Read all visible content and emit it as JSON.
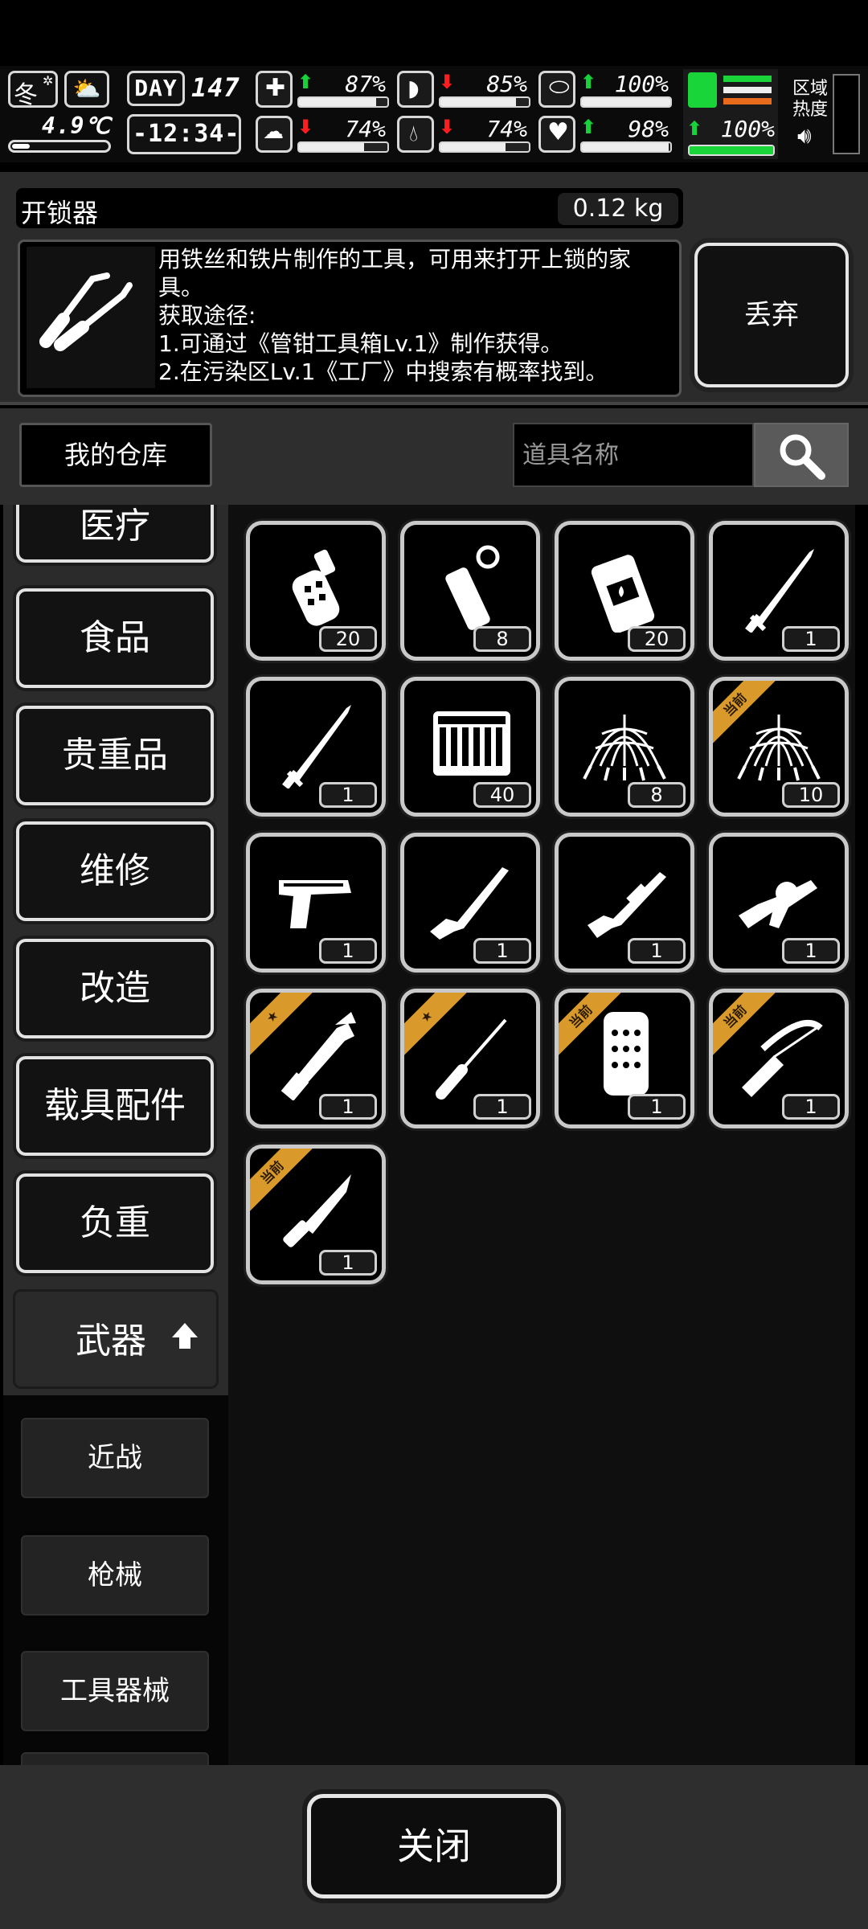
{
  "hud": {
    "season": "冬",
    "temperature": "4.9℃",
    "day_label": "DAY",
    "day_number": "147",
    "time": "-12:34-",
    "stats": [
      {
        "name": "health",
        "trend": "up",
        "percent": "87%",
        "level": 0.87
      },
      {
        "name": "hunger",
        "trend": "down",
        "percent": "85%",
        "level": 0.85
      },
      {
        "name": "sanity",
        "trend": "up",
        "percent": "100%",
        "level": 1.0
      },
      {
        "name": "energy",
        "trend": "down",
        "percent": "74%",
        "level": 0.74
      },
      {
        "name": "thirst",
        "trend": "down",
        "percent": "74%",
        "level": 0.74
      },
      {
        "name": "mood",
        "trend": "up",
        "percent": "98%",
        "level": 0.98
      }
    ],
    "stamina": {
      "trend": "up",
      "percent": "100%",
      "level": 1.0
    },
    "zone_heat_label": "区域热度"
  },
  "detail": {
    "item_name": "开锁器",
    "weight": "0.12 kg",
    "description": "用铁丝和铁片制作的工具，可用来打开上锁的家具。\n获取途径:\n1.可通过《管钳工具箱Lv.1》制作获得。\n2.在污染区Lv.1《工厂》中搜索有概率找到。",
    "discard_label": "丢弃"
  },
  "warehouse": {
    "label": "我的仓库",
    "search_placeholder": "道具名称"
  },
  "categories": {
    "medical": "医疗",
    "food": "食品",
    "valuables": "贵重品",
    "repair": "维修",
    "modify": "改造",
    "vehicle_parts": "载具配件",
    "load": "负重",
    "weapons": "武器"
  },
  "subcategories": {
    "melee": "近战",
    "firearms": "枪械",
    "tools": "工具器械"
  },
  "items": [
    {
      "icon": "grenade-icon",
      "count": "20"
    },
    {
      "icon": "flashbang-icon",
      "count": "8"
    },
    {
      "icon": "incendiary-grenade-icon",
      "count": "20"
    },
    {
      "icon": "katana-icon",
      "count": "1"
    },
    {
      "icon": "katana-icon",
      "count": "1"
    },
    {
      "icon": "ammo-box-icon",
      "count": "40"
    },
    {
      "icon": "net-trap-icon",
      "count": "8"
    },
    {
      "icon": "net-trap-icon",
      "count": "10",
      "badge": "当前"
    },
    {
      "icon": "pistol-icon",
      "count": "1"
    },
    {
      "icon": "rifle-icon",
      "count": "1"
    },
    {
      "icon": "shotgun-icon",
      "count": "1"
    },
    {
      "icon": "grenade-launcher-icon",
      "count": "1"
    },
    {
      "icon": "wrench-axe-icon",
      "count": "1",
      "badge": "★"
    },
    {
      "icon": "screwdriver-icon",
      "count": "1",
      "badge": "★"
    },
    {
      "icon": "riot-shield-icon",
      "count": "1",
      "badge": "当前"
    },
    {
      "icon": "crossbow-icon",
      "count": "1",
      "badge": "当前"
    },
    {
      "icon": "combat-knife-icon",
      "count": "1",
      "badge": "当前"
    }
  ],
  "footer": {
    "close_label": "关闭"
  }
}
